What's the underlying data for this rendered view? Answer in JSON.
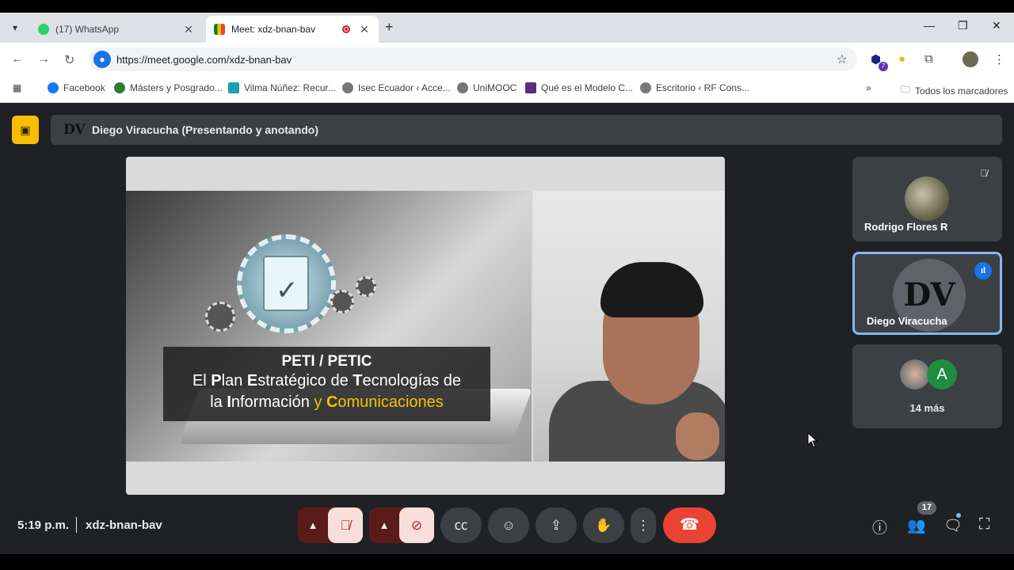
{
  "browser": {
    "tabs": [
      {
        "title": "(17) WhatsApp",
        "icon": "whatsapp-icon"
      },
      {
        "title": "Meet: xdz-bnan-bav",
        "icon": "meet-icon"
      }
    ],
    "url": "https://meet.google.com/xdz-bnan-bav",
    "bookmarks": [
      {
        "label": "Facebook",
        "color": "#1877f2"
      },
      {
        "label": "Másters y Posgrado...",
        "color": "#2e7d32"
      },
      {
        "label": "Vilma Núñez: Recur...",
        "color": "#1aa1b3"
      },
      {
        "label": "Isec Ecuador ‹ Acce...",
        "color": "#555555"
      },
      {
        "label": "UniMOOC",
        "color": "#555555"
      },
      {
        "label": "Qué es el Modelo C...",
        "color": "#5a2d82"
      },
      {
        "label": "Escritorio ‹ RF Cons...",
        "color": "#555555"
      }
    ],
    "all_bookmarks": "Todos los marcadores",
    "extension_badge": "7"
  },
  "meet": {
    "presenter_title": "Diego Viracucha (Presentando y anotando)",
    "logo_text": "DV",
    "slide": {
      "line1": "PETI / PETIC",
      "line2_parts": [
        {
          "t": "El ",
          "b": false
        },
        {
          "t": "P",
          "b": true
        },
        {
          "t": "lan ",
          "b": false
        },
        {
          "t": "E",
          "b": true
        },
        {
          "t": "stratégico de ",
          "b": false
        },
        {
          "t": "T",
          "b": true
        },
        {
          "t": "ecnologías de",
          "b": false
        }
      ],
      "line3_a": "la ",
      "line3_b": "I",
      "line3_c": "nformación ",
      "line3_y": "y ",
      "line3_d": "C",
      "line3_e": "omunicaciones"
    },
    "participants": [
      {
        "name": "Rodrigo Flores R"
      },
      {
        "name": "Diego Viracucha"
      }
    ],
    "more_avatar_letter": "A",
    "more_label": "14 más",
    "time": "5:19 p.m.",
    "meeting_code": "xdz-bnan-bav",
    "people_count": "17",
    "colors": {
      "accent": "#8ab4f8",
      "end_call": "#ea4335",
      "avatar_a": "#1e8e3e"
    }
  }
}
